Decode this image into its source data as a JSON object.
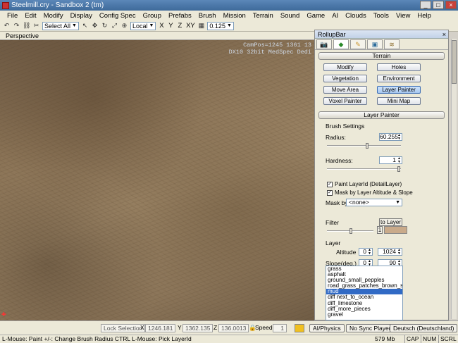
{
  "window": {
    "title": "Steelmill.cry - Sandbox 2 (tm)",
    "buttons": [
      "_",
      "□",
      "×"
    ]
  },
  "menubar": [
    "File",
    "Edit",
    "Modify",
    "Display",
    "Config Spec",
    "Group",
    "Prefabs",
    "Brush",
    "Mission",
    "Terrain",
    "Sound",
    "Game",
    "AI",
    "Clouds",
    "Tools",
    "View",
    "Help"
  ],
  "toolbar": {
    "select_filter": "Select All",
    "coord_system": "Local",
    "axes": [
      "X",
      "Y",
      "Z",
      "XY"
    ],
    "grid_value": "0.125",
    "icons": [
      "undo-icon",
      "redo-icon",
      "link-icon",
      "unlink-icon",
      "select-icon",
      "move-icon",
      "rotate-icon",
      "scale-icon",
      "snap-icon",
      "grid-icon"
    ]
  },
  "viewport": {
    "label": "Perspective",
    "overlay_line1": "CamPos=1245 1361 13",
    "overlay_line2": "DX10 32bit MedSpec Dedi"
  },
  "rollup": {
    "title": "RollupBar",
    "close": "×",
    "tabs": [
      "objects-tab",
      "terrain-tab",
      "modeling-tab",
      "display-tab",
      "layers-tab"
    ],
    "terrain_header": "Terrain",
    "terrain_buttons": [
      "Modify",
      "Holes",
      "Vegetation",
      "Environment",
      "Move Area",
      "Layer Painter",
      "Voxel Painter",
      "Mini Map"
    ],
    "active_button": "Layer Painter",
    "layer_painter_header": "Layer Painter",
    "brush_settings_label": "Brush Settings",
    "radius_label": "Radius:",
    "radius_value": "60.255",
    "radius_slider_fraction": 0.55,
    "hardness_label": "Hardness:",
    "hardness_value": "1",
    "hardness_slider_fraction": 1.0,
    "paint_layerid_label": "Paint LayerId (DetailLayer)",
    "paint_layerid_checked": "✓",
    "mask_altitude_label": "Mask by Layer Altitude & Slope",
    "mask_altitude_checked": "✓",
    "mask_by_label": "Mask by",
    "mask_by_value": "<none>",
    "filter_label": "Filter",
    "to_layer_button": "to Layer",
    "filter_value": "1",
    "filter_color": "#c9aa8a",
    "layer_label": "Layer",
    "altitude_label": "Altitude",
    "altitude_min": "0",
    "altitude_max": "1024",
    "slope_label": "Slope(deg.)",
    "slope_min": "0",
    "slope_max": "90",
    "layers": [
      "grass",
      "asphalt",
      "ground_small_pepples",
      "road_grass_patches_brown_soil",
      "mud",
      "diff next_to_ocean",
      "diff_limestone",
      "diff_more_pieces",
      "gravel"
    ],
    "selected_layer": "mud"
  },
  "bottombar": {
    "lock_selection": "Lock Selection",
    "x_label": "X",
    "x_value": "1246.181",
    "y_label": "Y",
    "y_value": "1362.135",
    "z_label": "Z",
    "z_value": "136.0013",
    "speed_label": "Speed:",
    "speed_value": "1",
    "ai_physics": "AI/Physics",
    "no_sync_player": "No Sync Player",
    "language": "Deutsch (Deutschland)"
  },
  "statusbar": {
    "message": "L-Mouse: Paint  +/-: Change Brush Radius   CTRL L-Mouse: Pick LayerId",
    "memory": "579 Mb",
    "cap": "CAP",
    "num": "NUM",
    "scrl": "SCRL"
  }
}
